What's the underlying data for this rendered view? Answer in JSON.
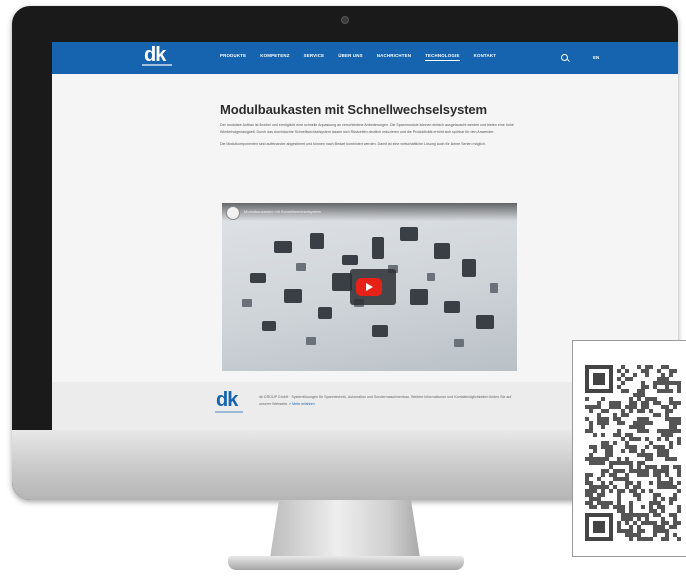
{
  "header": {
    "logo_text": "dk",
    "nav_items": [
      {
        "label": "PRODUKTE"
      },
      {
        "label": "KOMPETENZ"
      },
      {
        "label": "SERVICE"
      },
      {
        "label": "ÜBER UNS"
      },
      {
        "label": "NACHRICHTEN"
      },
      {
        "label": "TECHNOLOGIE",
        "active": true
      },
      {
        "label": "KONTAKT"
      }
    ],
    "language": "EN"
  },
  "article": {
    "title": "Modulbaukasten mit Schnellwechselsystem",
    "paragraphs": [
      "Der modulare Aufbau ist flexibel und ermöglicht eine schnelle Anpassung an verschiedene Anforderungen. Die Spannmodule können einfach ausgetauscht werden und bieten eine hohe Wiederholgenauigkeit. Durch das durchdachte Schnellwechselsystem lassen sich Rüstzeiten deutlich reduzieren und die Produktivität erhöht sich spürbar für den Anwender.",
      "Die Modulkomponenten sind aufeinander abgestimmt und können nach Bedarf kombiniert werden. Damit ist eine wirtschaftliche Lösung auch für kleine Serien möglich."
    ]
  },
  "video": {
    "title": "Modulbaukasten mit Schnellwechselsystem",
    "play_icon": "play-icon"
  },
  "footer": {
    "logo_text": "dk",
    "text": "dk GROUP GmbH · Systemlösungen für Spanntechnik, Automation und Sondermaschinenbau. Weitere Informationen und Kontaktmöglichkeiten finden Sie auf unserer Webseite.",
    "link_text": "» Mehr erfahren"
  },
  "colors": {
    "brand": "#1664b0",
    "video_play": "#e62117"
  }
}
